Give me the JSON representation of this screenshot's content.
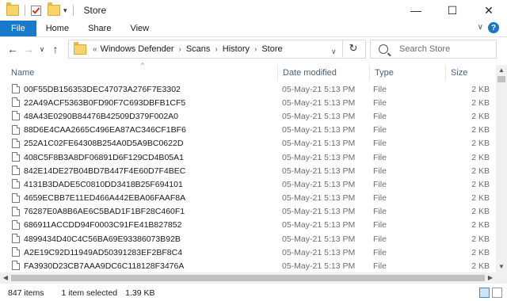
{
  "window": {
    "title": "Store",
    "controls": {
      "minimize": "—",
      "maximize": "☐",
      "close": "✕"
    }
  },
  "ribbon": {
    "tabs": [
      "File",
      "Home",
      "Share",
      "View"
    ],
    "help": "?",
    "collapse": "∨"
  },
  "nav": {
    "back": "←",
    "forward": "→",
    "recent": "∨",
    "up": "↑",
    "breadcrumb": [
      "Windows Defender",
      "Scans",
      "History",
      "Store"
    ],
    "overflow": "«",
    "refresh": "↻",
    "dropdown": "∨",
    "search_placeholder": "Search Store"
  },
  "columns": [
    "Name",
    "Date modified",
    "Type",
    "Size"
  ],
  "files": [
    {
      "name": "00F55DB156353DEC47073A276F7E3302",
      "date": "05-May-21 5:13 PM",
      "type": "File",
      "size": "2 KB"
    },
    {
      "name": "22A49ACF5363B0FD90F7C693DBFB1CF5",
      "date": "05-May-21 5:13 PM",
      "type": "File",
      "size": "2 KB"
    },
    {
      "name": "48A43E0290B84476B42509D379F002A0",
      "date": "05-May-21 5:13 PM",
      "type": "File",
      "size": "2 KB"
    },
    {
      "name": "88D6E4CAA2665C496EA87AC346CF1BF6",
      "date": "05-May-21 5:13 PM",
      "type": "File",
      "size": "2 KB"
    },
    {
      "name": "252A1C02FE64308B254A0D5A9BC0622D",
      "date": "05-May-21 5:13 PM",
      "type": "File",
      "size": "2 KB"
    },
    {
      "name": "408C5F8B3A8DF06891D6F129CD4B05A1",
      "date": "05-May-21 5:13 PM",
      "type": "File",
      "size": "2 KB"
    },
    {
      "name": "842E14DE27B04BD7B447F4E60D7F4BEC",
      "date": "05-May-21 5:13 PM",
      "type": "File",
      "size": "2 KB"
    },
    {
      "name": "4131B3DADE5C0810DD3418B25F694101",
      "date": "05-May-21 5:13 PM",
      "type": "File",
      "size": "2 KB"
    },
    {
      "name": "4659ECBB7E11ED466A442EBA06FAAF8A",
      "date": "05-May-21 5:13 PM",
      "type": "File",
      "size": "2 KB"
    },
    {
      "name": "76287E0A8B6AE6C5BAD1F1BF28C460F1",
      "date": "05-May-21 5:13 PM",
      "type": "File",
      "size": "2 KB"
    },
    {
      "name": "686911ACCDD94F0003C91FE41B827852",
      "date": "05-May-21 5:13 PM",
      "type": "File",
      "size": "2 KB"
    },
    {
      "name": "4899434D40C4C56BA69E93386073B92B",
      "date": "05-May-21 5:13 PM",
      "type": "File",
      "size": "2 KB"
    },
    {
      "name": "A2E19C92D11949AD50391283EF2BF8C4",
      "date": "05-May-21 5:13 PM",
      "type": "File",
      "size": "2 KB"
    },
    {
      "name": "FA3930D23CB7AAA9DC6C118128F3476A",
      "date": "05-May-21 5:13 PM",
      "type": "File",
      "size": "2 KB"
    }
  ],
  "scroll": {
    "up": "▲",
    "down": "▼",
    "left": "◀",
    "right": "▶"
  },
  "status": {
    "count": "847 items",
    "selection": "1 item selected",
    "selection_size": "1.39 KB"
  },
  "colors": {
    "file_tab": "#1979ca",
    "header_text": "#4c607a",
    "secondary_text": "#6d6d6d"
  }
}
